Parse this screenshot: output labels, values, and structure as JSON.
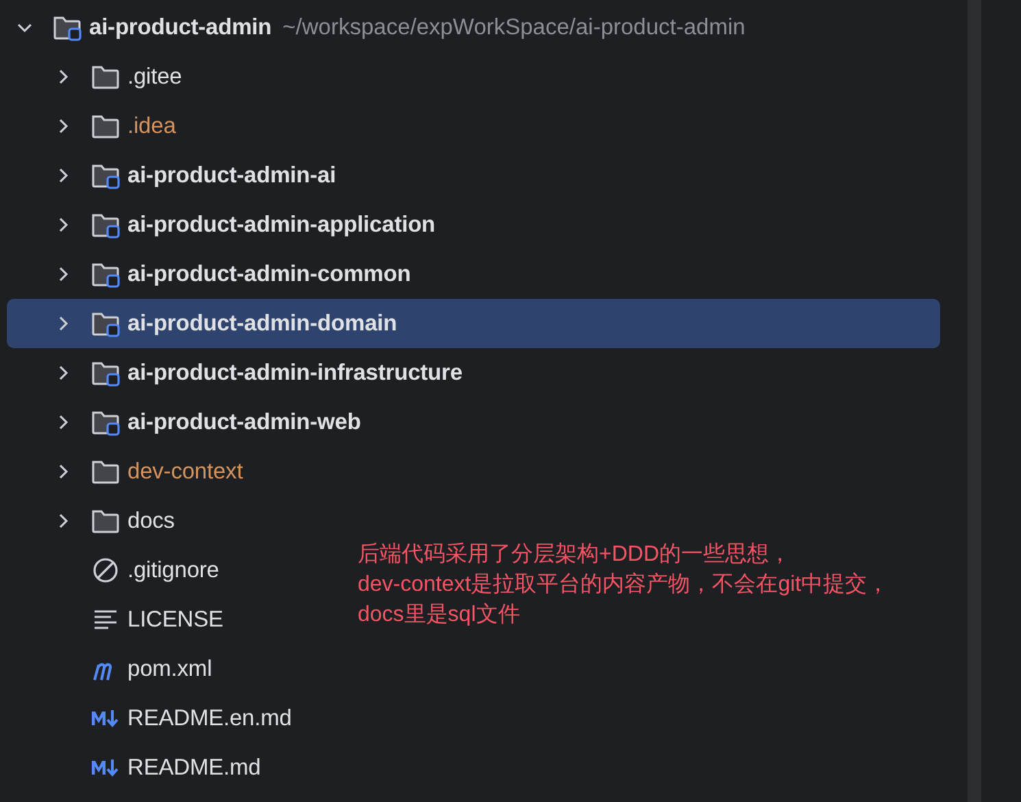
{
  "tree": {
    "name": "ai-product-admin",
    "path": "~/workspace/expWorkSpace/ai-product-admin",
    "kind": "module",
    "expanded": true,
    "selected": false,
    "children": [
      {
        "name": ".gitee",
        "kind": "folder",
        "expanded": false,
        "selected": false,
        "ignored": false
      },
      {
        "name": ".idea",
        "kind": "folder",
        "expanded": false,
        "selected": false,
        "ignored": true
      },
      {
        "name": "ai-product-admin-ai",
        "kind": "module",
        "expanded": false,
        "selected": false,
        "ignored": false
      },
      {
        "name": "ai-product-admin-application",
        "kind": "module",
        "expanded": false,
        "selected": false,
        "ignored": false
      },
      {
        "name": "ai-product-admin-common",
        "kind": "module",
        "expanded": false,
        "selected": false,
        "ignored": false
      },
      {
        "name": "ai-product-admin-domain",
        "kind": "module",
        "expanded": false,
        "selected": true,
        "ignored": false
      },
      {
        "name": "ai-product-admin-infrastructure",
        "kind": "module",
        "expanded": false,
        "selected": false,
        "ignored": false
      },
      {
        "name": "ai-product-admin-web",
        "kind": "module",
        "expanded": false,
        "selected": false,
        "ignored": false
      },
      {
        "name": "dev-context",
        "kind": "folder",
        "expanded": false,
        "selected": false,
        "ignored": true
      },
      {
        "name": "docs",
        "kind": "folder",
        "expanded": false,
        "selected": false,
        "ignored": false
      },
      {
        "name": ".gitignore",
        "kind": "ignore-file",
        "selected": false,
        "ignored": false
      },
      {
        "name": "LICENSE",
        "kind": "text-file",
        "selected": false,
        "ignored": false
      },
      {
        "name": "pom.xml",
        "kind": "maven-file",
        "selected": false,
        "ignored": false
      },
      {
        "name": "README.en.md",
        "kind": "markdown-file",
        "selected": false,
        "ignored": false
      },
      {
        "name": "README.md",
        "kind": "markdown-file",
        "selected": false,
        "ignored": false
      }
    ]
  },
  "note": [
    "后端代码采用了分层架构+DDD的一些思想，",
    "dev-context是拉取平台的内容产物，不会在git中提交，",
    "docs里是sql文件"
  ]
}
